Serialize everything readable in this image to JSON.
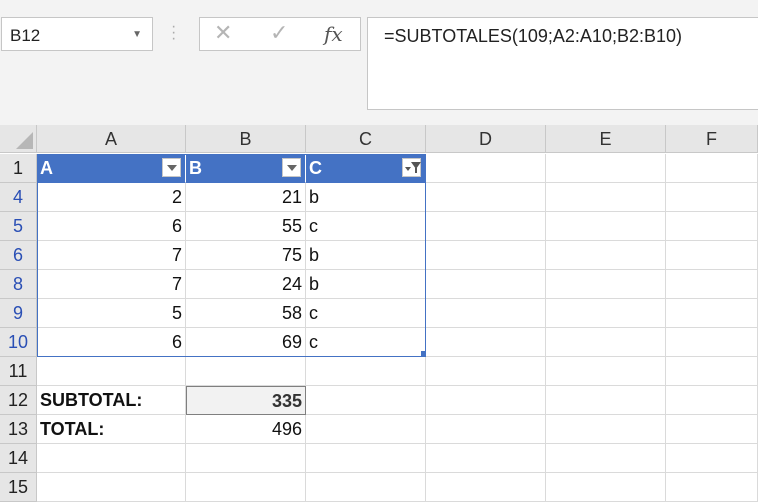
{
  "name_box": {
    "value": "B12"
  },
  "formula_bar": {
    "cancel_icon": "close-icon",
    "enter_icon": "check-icon",
    "fx_label": "fx",
    "formula": "=SUBTOTALES(109;A2:A10;B2:B10)"
  },
  "columns": [
    "A",
    "B",
    "C",
    "D",
    "E",
    "F"
  ],
  "rows": [
    {
      "num": "1",
      "filtered": false,
      "cells": [
        "A",
        "B",
        "C",
        "",
        "",
        ""
      ]
    },
    {
      "num": "4",
      "filtered": true,
      "cells": [
        "2",
        "21",
        "b",
        "",
        "",
        ""
      ]
    },
    {
      "num": "5",
      "filtered": true,
      "cells": [
        "6",
        "55",
        "c",
        "",
        "",
        ""
      ]
    },
    {
      "num": "6",
      "filtered": true,
      "cells": [
        "7",
        "75",
        "b",
        "",
        "",
        ""
      ]
    },
    {
      "num": "8",
      "filtered": true,
      "cells": [
        "7",
        "24",
        "b",
        "",
        "",
        ""
      ]
    },
    {
      "num": "9",
      "filtered": true,
      "cells": [
        "5",
        "58",
        "c",
        "",
        "",
        ""
      ]
    },
    {
      "num": "10",
      "filtered": true,
      "cells": [
        "6",
        "69",
        "c",
        "",
        "",
        ""
      ]
    },
    {
      "num": "11",
      "filtered": false,
      "cells": [
        "",
        "",
        "",
        "",
        "",
        ""
      ]
    },
    {
      "num": "12",
      "filtered": false,
      "cells": [
        "SUBTOTAL:",
        "335",
        "",
        "",
        "",
        ""
      ]
    },
    {
      "num": "13",
      "filtered": false,
      "cells": [
        "TOTAL:",
        "496",
        "",
        "",
        "",
        ""
      ]
    },
    {
      "num": "14",
      "filtered": false,
      "cells": [
        "",
        "",
        "",
        "",
        "",
        ""
      ]
    },
    {
      "num": "15",
      "filtered": false,
      "cells": [
        "",
        "",
        "",
        "",
        "",
        ""
      ]
    }
  ],
  "table_colors": {
    "header_bg": "#4472c4",
    "header_text": "#ffffff",
    "filtered_row_number": "#2a4fb5"
  }
}
